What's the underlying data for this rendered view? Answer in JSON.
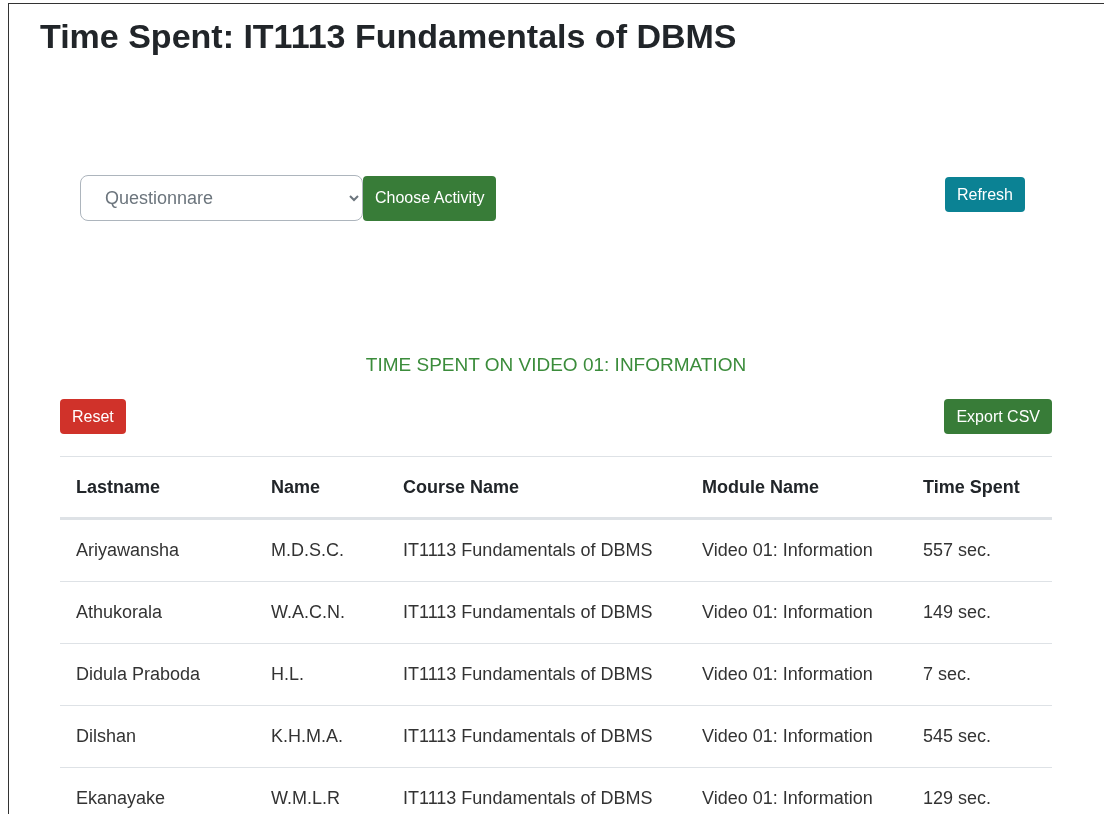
{
  "page_title": "Time Spent: IT1113 Fundamentals of DBMS",
  "activity_select": {
    "value": "Questionnare"
  },
  "buttons": {
    "choose": "Choose Activity",
    "refresh": "Refresh",
    "reset": "Reset",
    "export": "Export CSV"
  },
  "section_title": "TIME SPENT ON VIDEO 01: INFORMATION",
  "table": {
    "columns": [
      "Lastname",
      "Name",
      "Course Name",
      "Module Name",
      "Time Spent"
    ],
    "rows": [
      [
        "Ariyawansha",
        "M.D.S.C.",
        "IT1113 Fundamentals of DBMS",
        "Video 01: Information",
        "557 sec."
      ],
      [
        "Athukorala",
        "W.A.C.N.",
        "IT1113 Fundamentals of DBMS",
        "Video 01: Information",
        "149 sec."
      ],
      [
        "Didula Praboda",
        "H.L.",
        "IT1113 Fundamentals of DBMS",
        "Video 01: Information",
        "7 sec."
      ],
      [
        "Dilshan",
        "K.H.M.A.",
        "IT1113 Fundamentals of DBMS",
        "Video 01: Information",
        "545 sec."
      ],
      [
        "Ekanayake",
        "W.M.L.R",
        "IT1113 Fundamentals of DBMS",
        "Video 01: Information",
        "129 sec."
      ]
    ]
  }
}
